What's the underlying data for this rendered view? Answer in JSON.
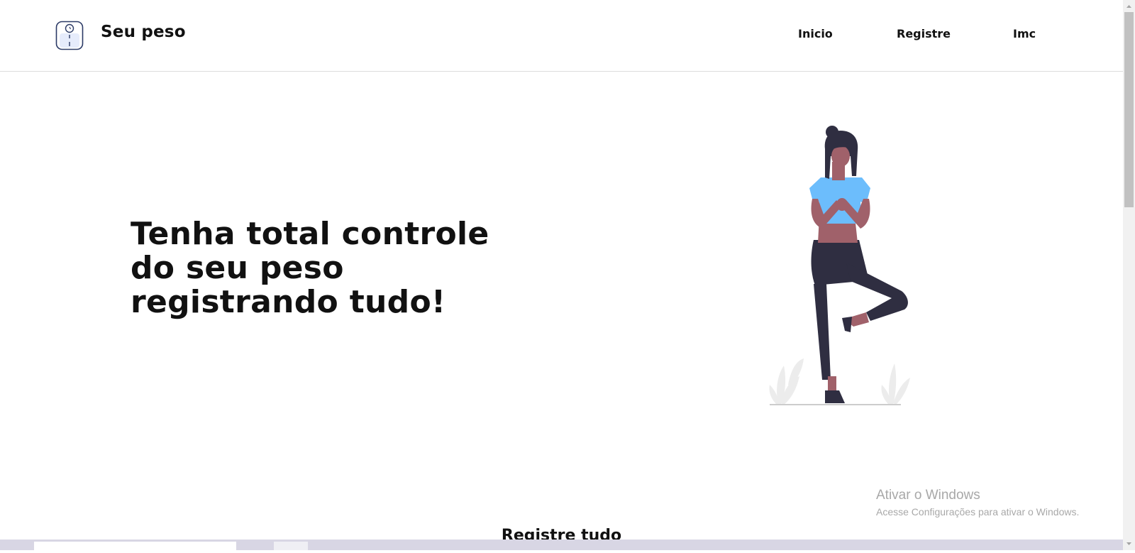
{
  "header": {
    "brand": "Seu peso",
    "logo_icon": "scale-icon",
    "nav": [
      {
        "label": "Inicio"
      },
      {
        "label": "Registre"
      },
      {
        "label": "Imc"
      }
    ]
  },
  "hero": {
    "title": "Tenha total controle do seu peso registrando tudo!",
    "illustration_icon": "woman-yoga-illustration"
  },
  "section": {
    "title": "Registre tudo"
  },
  "watermark": {
    "title": "Ativar o Windows",
    "subtitle": "Acesse Configurações para ativar o Windows."
  },
  "colors": {
    "shirt": "#6cbdfc",
    "pants": "#2f2e41",
    "skin": "#a0616a",
    "plants": "#ececec",
    "text": "#111111"
  }
}
